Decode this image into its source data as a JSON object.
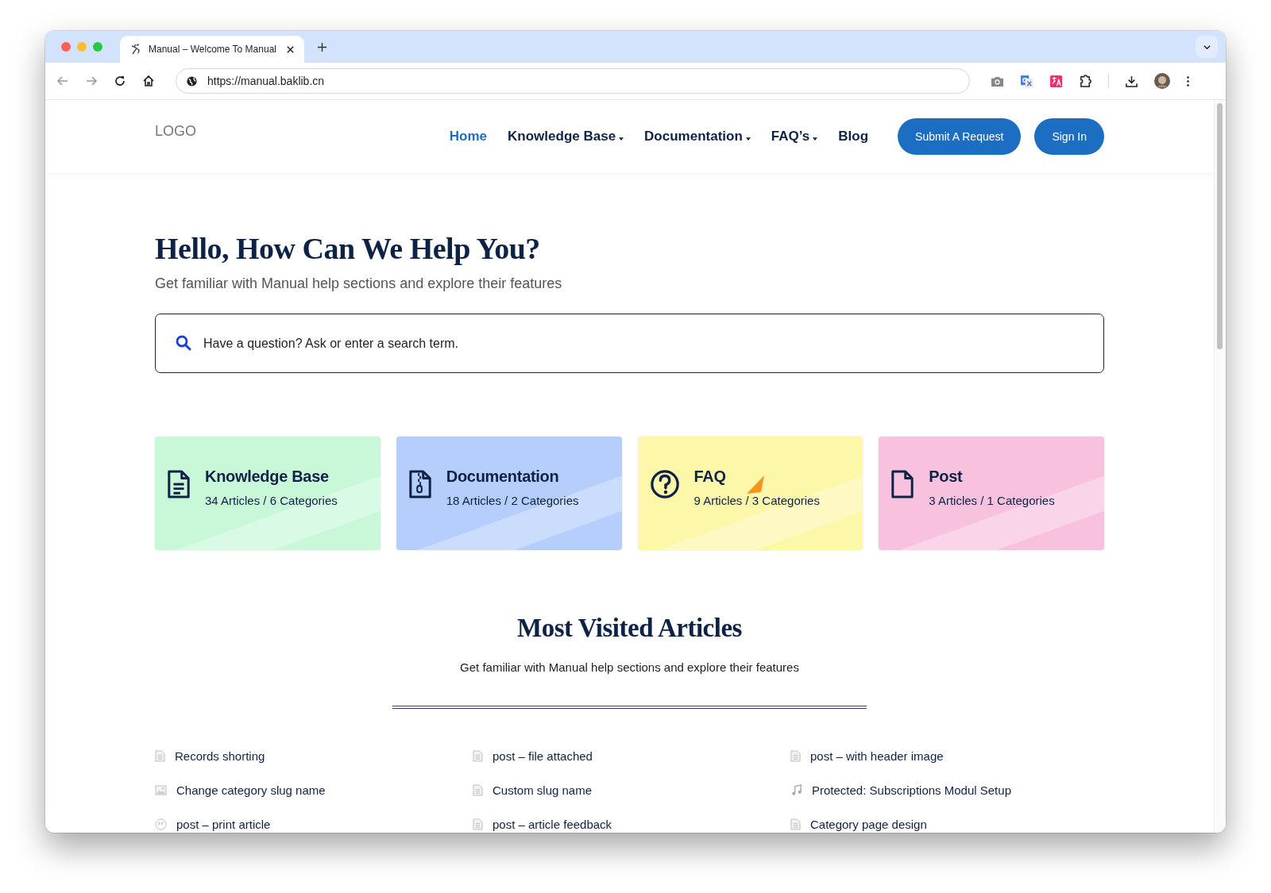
{
  "browser": {
    "tab_title": "Manual – Welcome To Manual",
    "url": "https://manual.baklib.cn"
  },
  "header": {
    "logo": "LOGO",
    "nav": [
      {
        "label": "Home",
        "selected": true,
        "dropdown": false
      },
      {
        "label": "Knowledge Base",
        "selected": false,
        "dropdown": true
      },
      {
        "label": "Documentation",
        "selected": false,
        "dropdown": true
      },
      {
        "label": "FAQ’s",
        "selected": false,
        "dropdown": true
      },
      {
        "label": "Blog",
        "selected": false,
        "dropdown": false
      }
    ],
    "buttons": [
      "Submit A Request",
      "Sign In"
    ]
  },
  "hero": {
    "title": "Hello, How Can We Help You?",
    "subtitle": "Get familiar with Manual help sections and explore their features",
    "search": {
      "placeholder": "Have a question? Ask or enter a search term."
    }
  },
  "categories": [
    {
      "title": "Knowledge Base",
      "meta": "34 Articles / 6 Categories",
      "color": "#c9f8d9",
      "kind": "document"
    },
    {
      "title": "Documentation",
      "meta": "18 Articles / 2 Categories",
      "color": "#b5cefb",
      "kind": "archive"
    },
    {
      "title": "FAQ",
      "meta": "9 Articles / 3 Categories",
      "color": "#fdf7a9",
      "kind": "question"
    },
    {
      "title": "Post",
      "meta": "3 Articles / 1 Categories",
      "color": "#f8c2df",
      "kind": "blank"
    }
  ],
  "most_visited": {
    "title": "Most Visited Articles",
    "subtitle": "Get familiar with Manual help sections and explore their features",
    "articles": [
      {
        "title": "Records shorting",
        "kind": "document"
      },
      {
        "title": "post – file attached",
        "kind": "document"
      },
      {
        "title": "post – with header image",
        "kind": "document"
      },
      {
        "title": "Change category slug name",
        "kind": "image"
      },
      {
        "title": "Custom slug name",
        "kind": "document"
      },
      {
        "title": "Protected: Subscriptions Modul Setup",
        "kind": "audio"
      },
      {
        "title": "post – print article",
        "kind": "quote"
      },
      {
        "title": "post – article feedback",
        "kind": "document"
      },
      {
        "title": "Category page design",
        "kind": "document"
      }
    ]
  }
}
